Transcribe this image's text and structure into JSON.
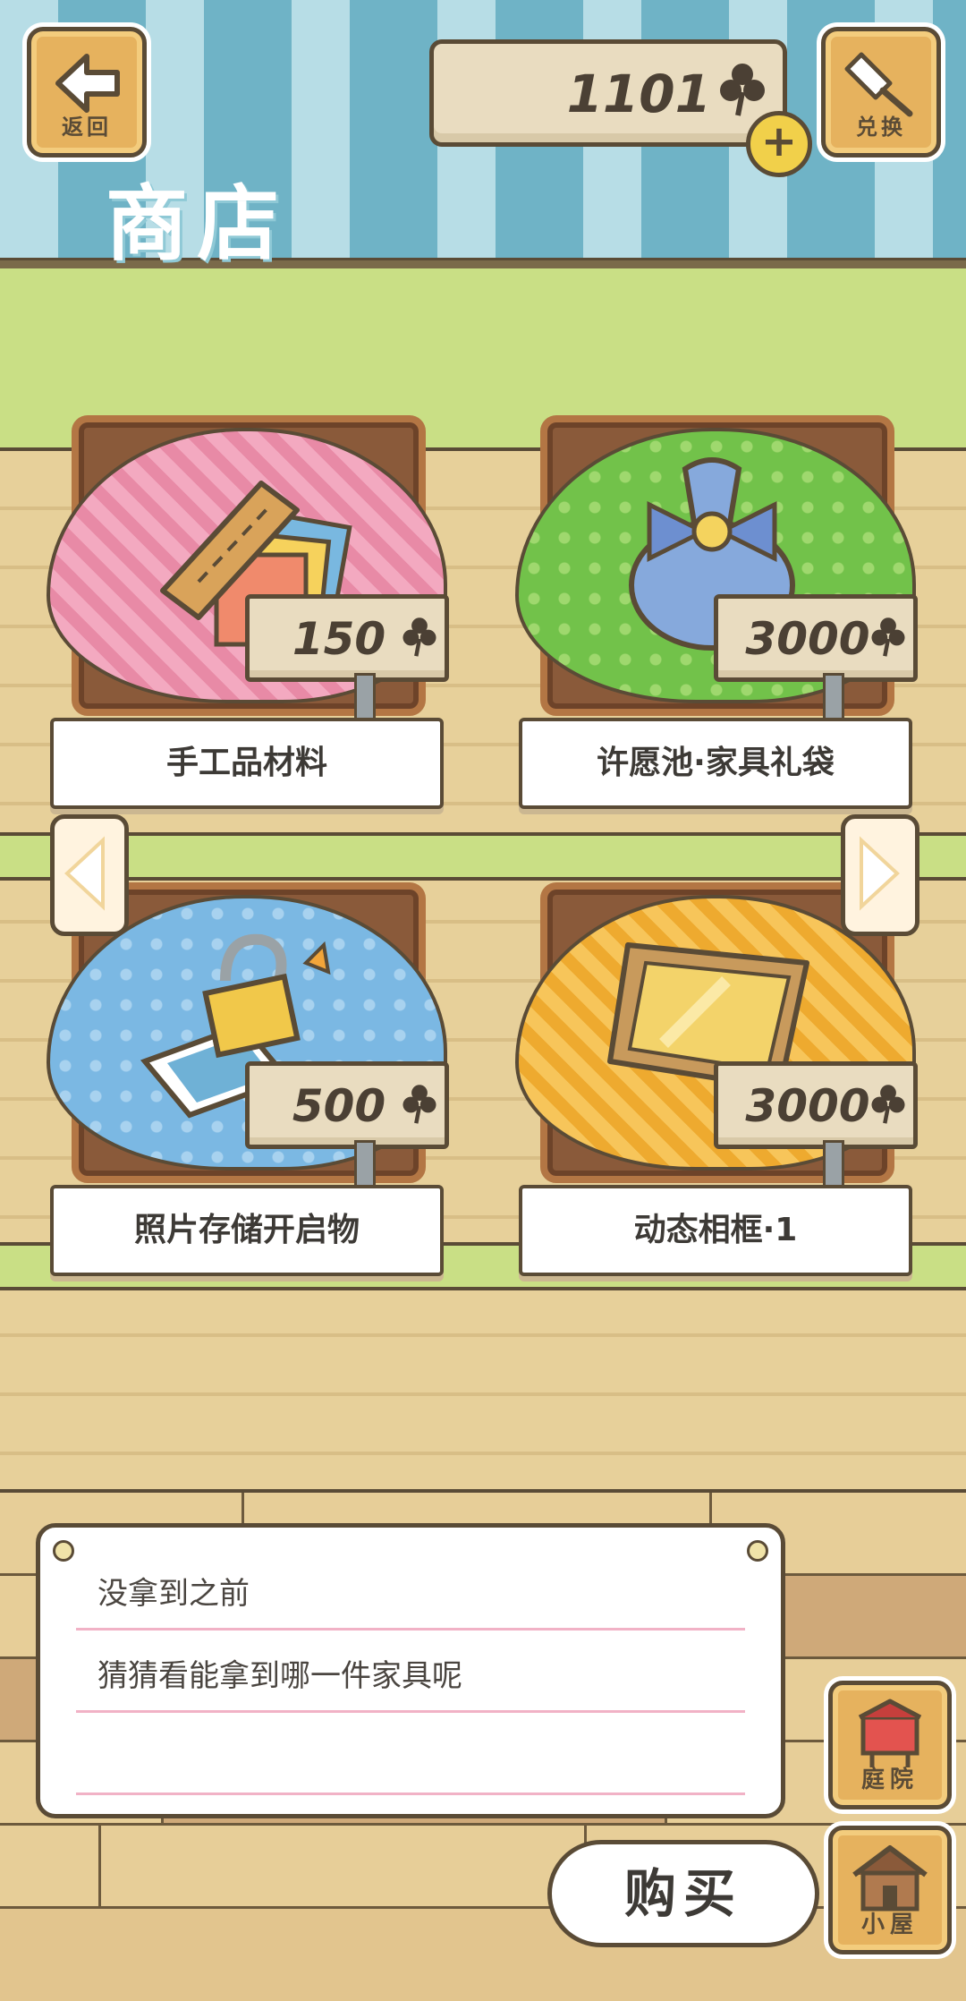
{
  "header": {
    "back_label": "返回",
    "exchange_label": "兑换",
    "title": "商店",
    "currency_amount": "1101",
    "currency_icon": "clover-icon",
    "add_currency_symbol": "+"
  },
  "items": [
    {
      "name": "手工品材料",
      "price": "150"
    },
    {
      "name": "许愿池·家具礼袋",
      "price": "3000"
    },
    {
      "name": "照片存储开启物",
      "price": "500"
    },
    {
      "name": "动态相框·1",
      "price": "3000"
    }
  ],
  "message": {
    "line1": "没拿到之前",
    "line2": "猜猜看能拿到哪一件家具呢",
    "line3": ""
  },
  "buttons": {
    "buy": "购买",
    "yard": "庭院",
    "house": "小屋"
  },
  "colors": {
    "awning_light": "#b7dde6",
    "awning_dark": "#6fb3c6",
    "wall_green": "#c9df85",
    "wood_button": "#e6b25e",
    "outline": "#5a4b36"
  }
}
